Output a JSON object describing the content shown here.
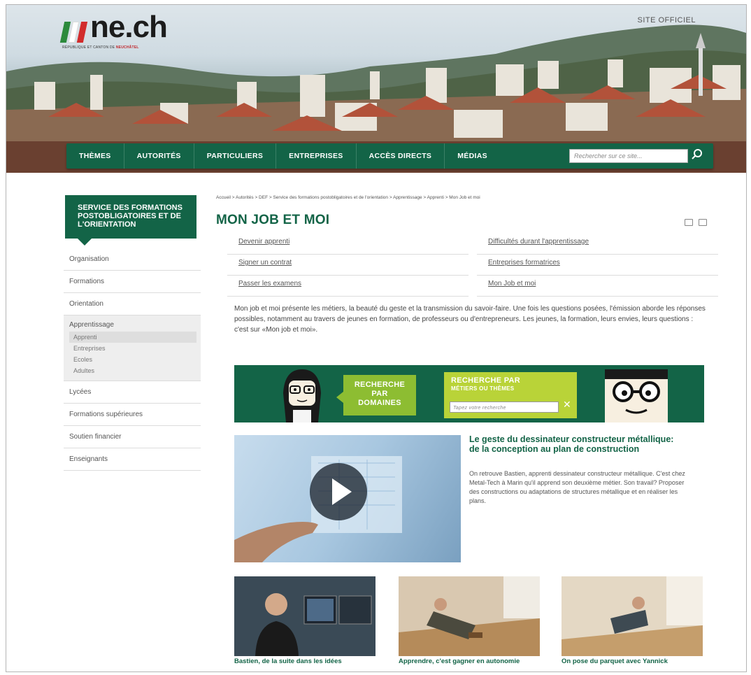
{
  "header": {
    "logo_text": "ne.ch",
    "logo_subtitle_prefix": "RÉPUBLIQUE ET CANTON DE",
    "logo_subtitle_highlight": "NEUCHÂTEL",
    "site_label": "SITE OFFICIEL",
    "flag_colors": [
      "#2c8a3c",
      "#ffffff",
      "#d22c2c"
    ]
  },
  "nav": {
    "items": [
      "THÈMES",
      "AUTORITÉS",
      "PARTICULIERS",
      "ENTREPRISES",
      "ACCÈS DIRECTS",
      "MÉDIAS"
    ],
    "search_placeholder": "Rechercher sur ce site..."
  },
  "sidebar": {
    "title": "SERVICE DES FORMATIONS POSTOBLIGATOIRES ET DE L'ORIENTATION",
    "items": [
      "Organisation",
      "Formations",
      "Orientation"
    ],
    "group": {
      "title": "Apprentissage",
      "subitems": [
        "Apprenti",
        "Entreprises",
        "Ecoles",
        "Adultes"
      ]
    },
    "items_after": [
      "Lycées",
      "Formations supérieures",
      "Soutien financier",
      "Enseignants"
    ]
  },
  "main": {
    "breadcrumb": "Accueil  >  Autorités  >  DEF  >  Service des formations postobligatoires et de l'orientation  >  Apprentissage  >  Apprenti  >  Mon Job et moi",
    "title": "MON JOB ET MOI",
    "links": [
      "Devenir apprenti",
      "Difficultés durant l'apprentissage",
      "Signer un contrat",
      "Entreprises formatrices",
      "Passer les examens",
      "Mon Job et moi"
    ],
    "intro": "Mon job et moi présente les métiers, la beauté du geste et la transmission du savoir-faire. Une fois les questions posées, l'émission aborde les réponses possibles, notamment au travers de jeunes en formation, de professeurs ou d'entrepreneurs. Les jeunes, la formation, leurs envies, leurs questions : c'est sur «Mon job et moi».",
    "promo": {
      "box1_line1": "RECHERCHE",
      "box1_line2": "PAR",
      "box1_line3": "DOMAINES",
      "box2_line1": "RECHERCHE PAR",
      "box2_line2": "MÉTIERS OU THÈMES",
      "input_placeholder": "Tapez votre recherche",
      "close": "✕"
    },
    "feature": {
      "title": "Le geste du dessinateur constructeur métallique: de la conception au plan de construction",
      "description": "On retrouve Bastien, apprenti dessinateur constructeur métallique. C'est chez Metal-Tech à Marin qu'il apprend son deuxième métier. Son travail? Proposer des constructions ou adaptations de structures métallique et en réaliser les plans."
    },
    "thumbnails": [
      {
        "caption": "Bastien, de la suite dans les idées"
      },
      {
        "caption": "Apprendre, c'est gagner en autonomie"
      },
      {
        "caption": "On pose du parquet avec Yannick"
      }
    ]
  },
  "colors": {
    "brand_green": "#136447",
    "lime": "#8dbd32",
    "lime_light": "#b9d338"
  }
}
